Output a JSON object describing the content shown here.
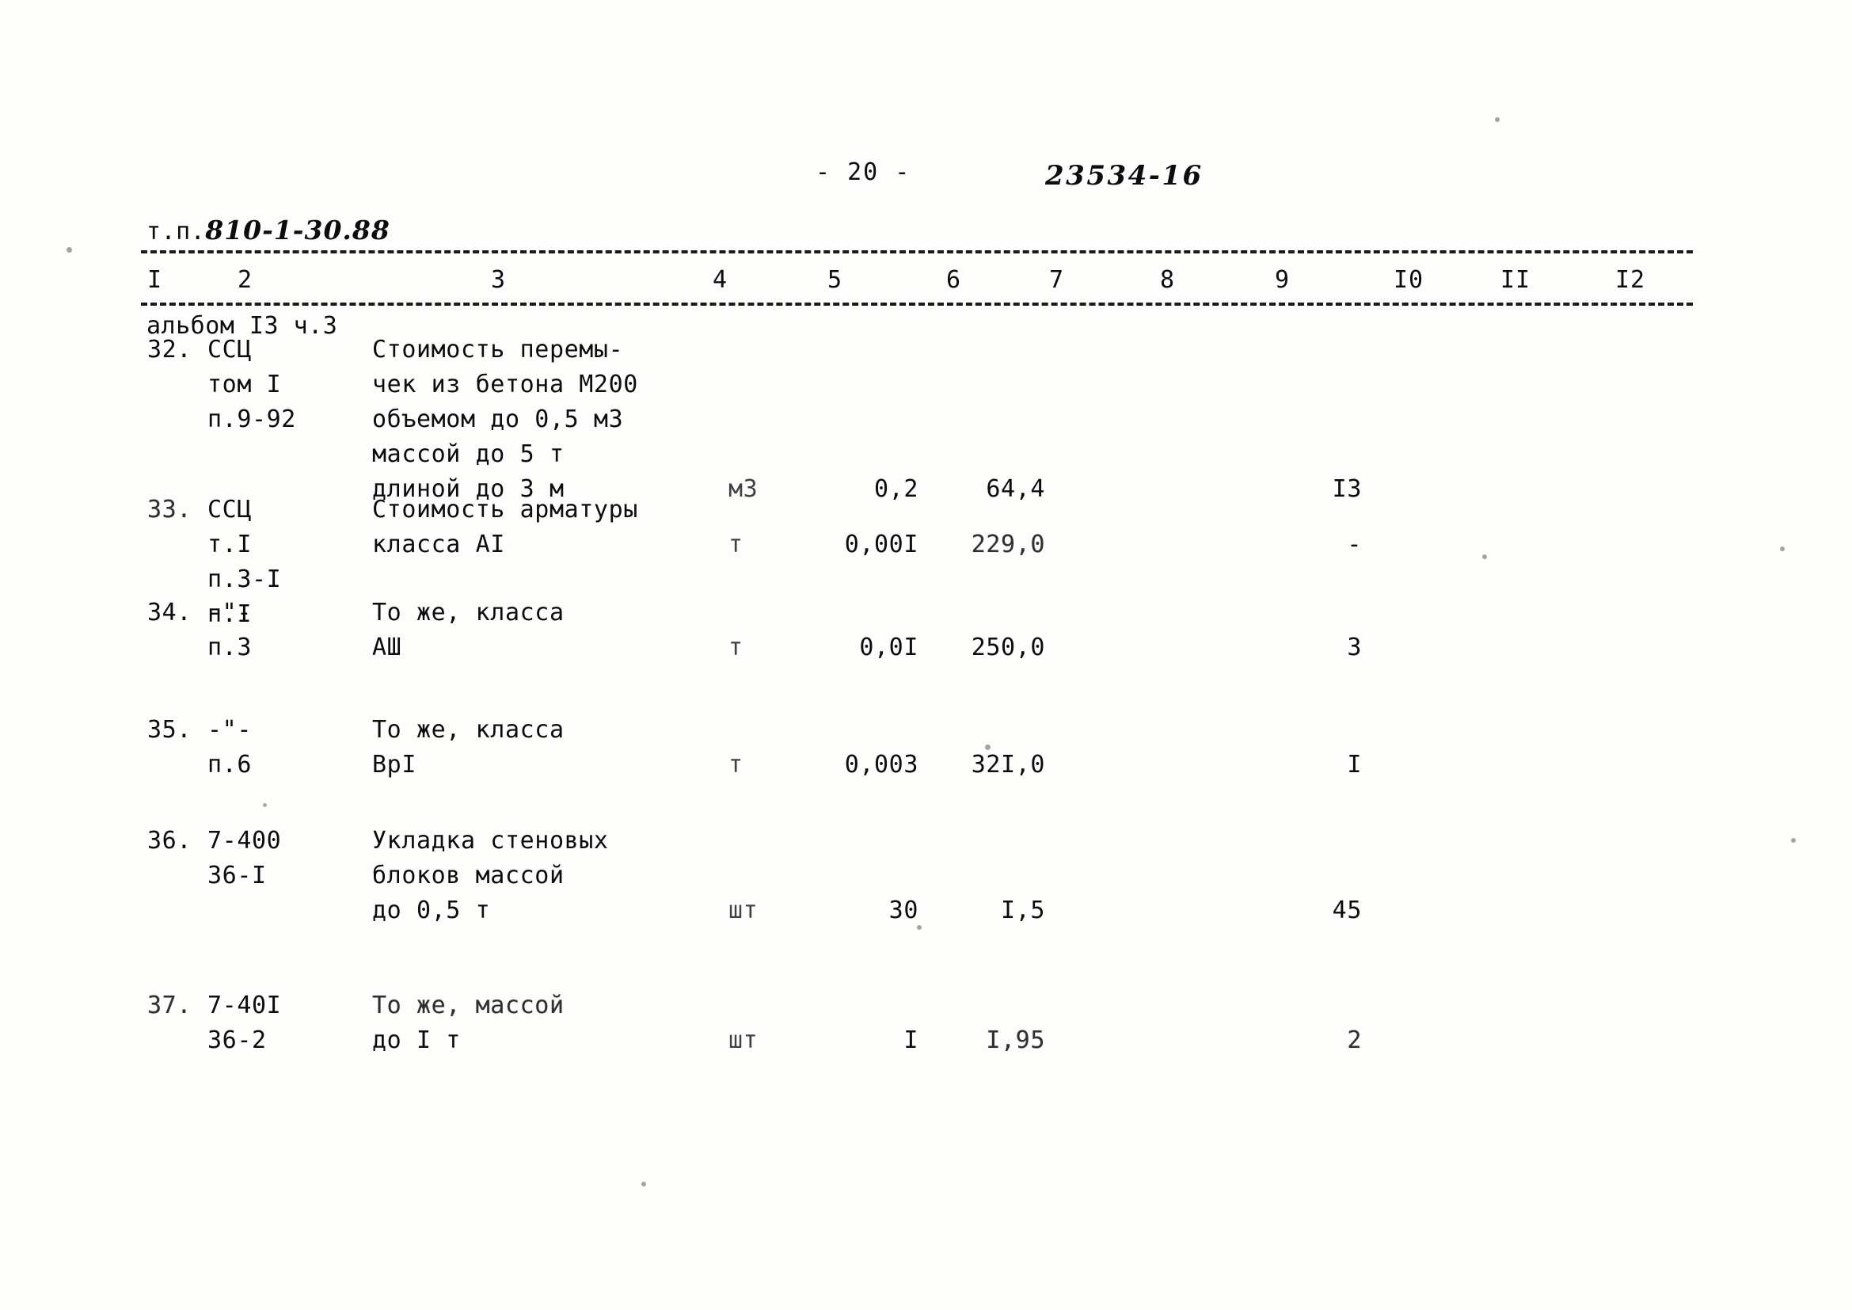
{
  "header": {
    "doc_prefix": "т.п.",
    "doc_number": "810-1-30.88",
    "album_line": "альбом I3 ч.3",
    "page_number": "- 20 -",
    "doc_code": "23534-16"
  },
  "table": {
    "column_headers": [
      "I",
      "2",
      "3",
      "4",
      "5",
      "6",
      "7",
      "8",
      "9",
      "I0",
      "II",
      "I2"
    ],
    "rows": [
      {
        "number": "32.",
        "code": [
          "ССЦ",
          "том I",
          "п.9-92"
        ],
        "description": [
          "Стоимость перемы-",
          "чек из бетона М200",
          "объемом до 0,5 м3",
          "массой до 5 т",
          "длиной до 3 м"
        ],
        "unit": "м3",
        "col5": "0,2",
        "col6": "64,4",
        "col7": "",
        "col8": "",
        "col9": "I3",
        "col10": "",
        "col11": "",
        "col12": "",
        "value_line": 4
      },
      {
        "number": "33.",
        "code": [
          "ССЦ",
          "т.I",
          "п.3-I",
          "п.I"
        ],
        "description": [
          "Стоимость арматуры",
          "класса АI"
        ],
        "unit": "т",
        "col5": "0,00I",
        "col6": "229,0",
        "col7": "",
        "col8": "",
        "col9": "-",
        "col10": "",
        "col11": "",
        "col12": "",
        "value_line": 1
      },
      {
        "number": "34.",
        "code": [
          "-\"-",
          "п.3"
        ],
        "description": [
          "То же, класса",
          "АШ"
        ],
        "unit": "т",
        "col5": "0,0I",
        "col6": "250,0",
        "col7": "",
        "col8": "",
        "col9": "3",
        "col10": "",
        "col11": "",
        "col12": "",
        "value_line": 1
      },
      {
        "number": "35.",
        "code": [
          "-\"-",
          "п.6"
        ],
        "description": [
          "То же, класса",
          "ВрI"
        ],
        "unit": "т",
        "col5": "0,003",
        "col6": "32I,0",
        "col7": "",
        "col8": "",
        "col9": "I",
        "col10": "",
        "col11": "",
        "col12": "",
        "value_line": 1
      },
      {
        "number": "36.",
        "code": [
          "7-400",
          "36-I"
        ],
        "description": [
          "Укладка стеновых",
          "блоков массой",
          "до 0,5 т"
        ],
        "unit": "шт",
        "col5": "30",
        "col6": "I,5",
        "col7": "",
        "col8": "",
        "col9": "45",
        "col10": "",
        "col11": "",
        "col12": "",
        "value_line": 2
      },
      {
        "number": "37.",
        "code": [
          "7-40I",
          "36-2"
        ],
        "description": [
          "То же, массой",
          "до I т"
        ],
        "unit": "шт",
        "col5": "I",
        "col6": "I,95",
        "col7": "",
        "col8": "",
        "col9": "2",
        "col10": "",
        "col11": "",
        "col12": "",
        "value_line": 1
      }
    ]
  },
  "layout": {
    "column_header_x": [
      186,
      300,
      620,
      900,
      1045,
      1195,
      1325,
      1465,
      1610,
      1760,
      1895,
      2040
    ],
    "row_tops": [
      0,
      202,
      332,
      480,
      620,
      828
    ],
    "line_height": 44
  },
  "colors": {
    "ink": "#0d0d0d",
    "paper": "#fdfdfb"
  }
}
